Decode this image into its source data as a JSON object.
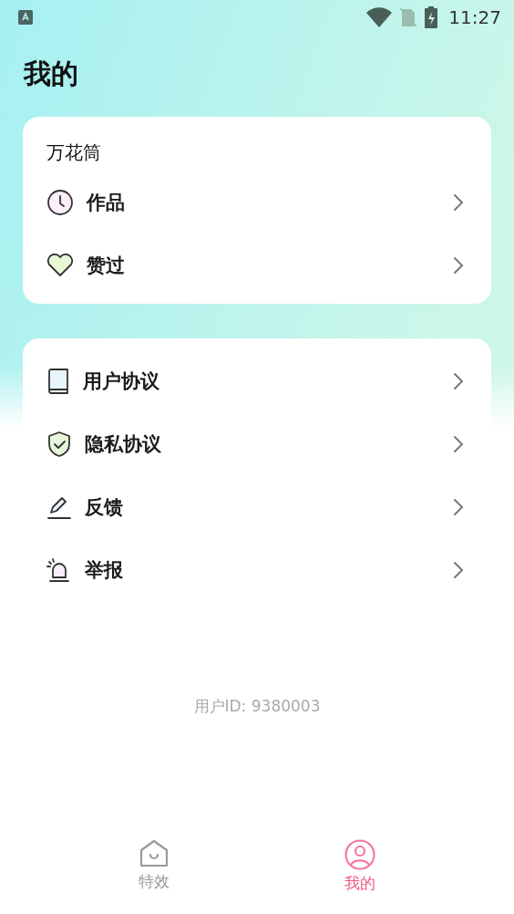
{
  "status_bar": {
    "time": "11:27"
  },
  "title": "我的",
  "collection_card": {
    "heading": "万花筒",
    "items": [
      {
        "label": "作品"
      },
      {
        "label": "赞过"
      }
    ]
  },
  "settings_card": {
    "items": [
      {
        "label": "用户协议"
      },
      {
        "label": "隐私协议"
      },
      {
        "label": "反馈"
      },
      {
        "label": "举报"
      }
    ]
  },
  "user_id": "用户ID: 9380003",
  "tabs": [
    {
      "label": "特效",
      "selected": false
    },
    {
      "label": "我的",
      "selected": true
    }
  ]
}
